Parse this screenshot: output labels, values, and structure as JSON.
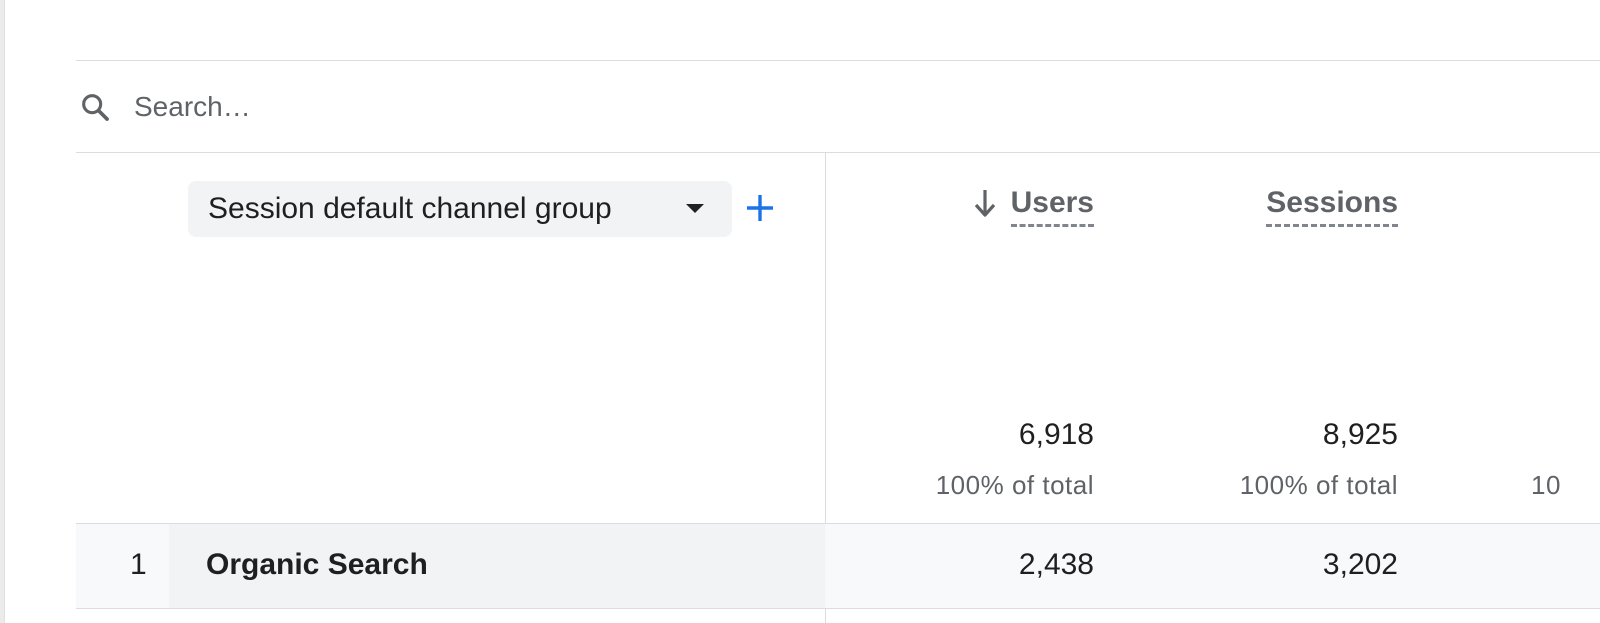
{
  "search": {
    "placeholder": "Search…",
    "icon": "search-icon"
  },
  "dimension": {
    "label": "Session default channel group",
    "dropdown_icon": "caret-down-icon",
    "add_icon": "plus-icon",
    "accent_color": "#1a73e8"
  },
  "metrics": [
    {
      "label": "Users",
      "sorted": "descending",
      "sort_icon": "arrow-down-icon"
    },
    {
      "label": "Sessions"
    }
  ],
  "totals": [
    {
      "value": "6,918",
      "pct": "100% of total"
    },
    {
      "value": "8,925",
      "pct": "100% of total"
    }
  ],
  "clipped_next_column_pct": "10",
  "rows": [
    {
      "index": "1",
      "channel": "Organic Search",
      "values": [
        "2,438",
        "3,202"
      ]
    }
  ]
}
